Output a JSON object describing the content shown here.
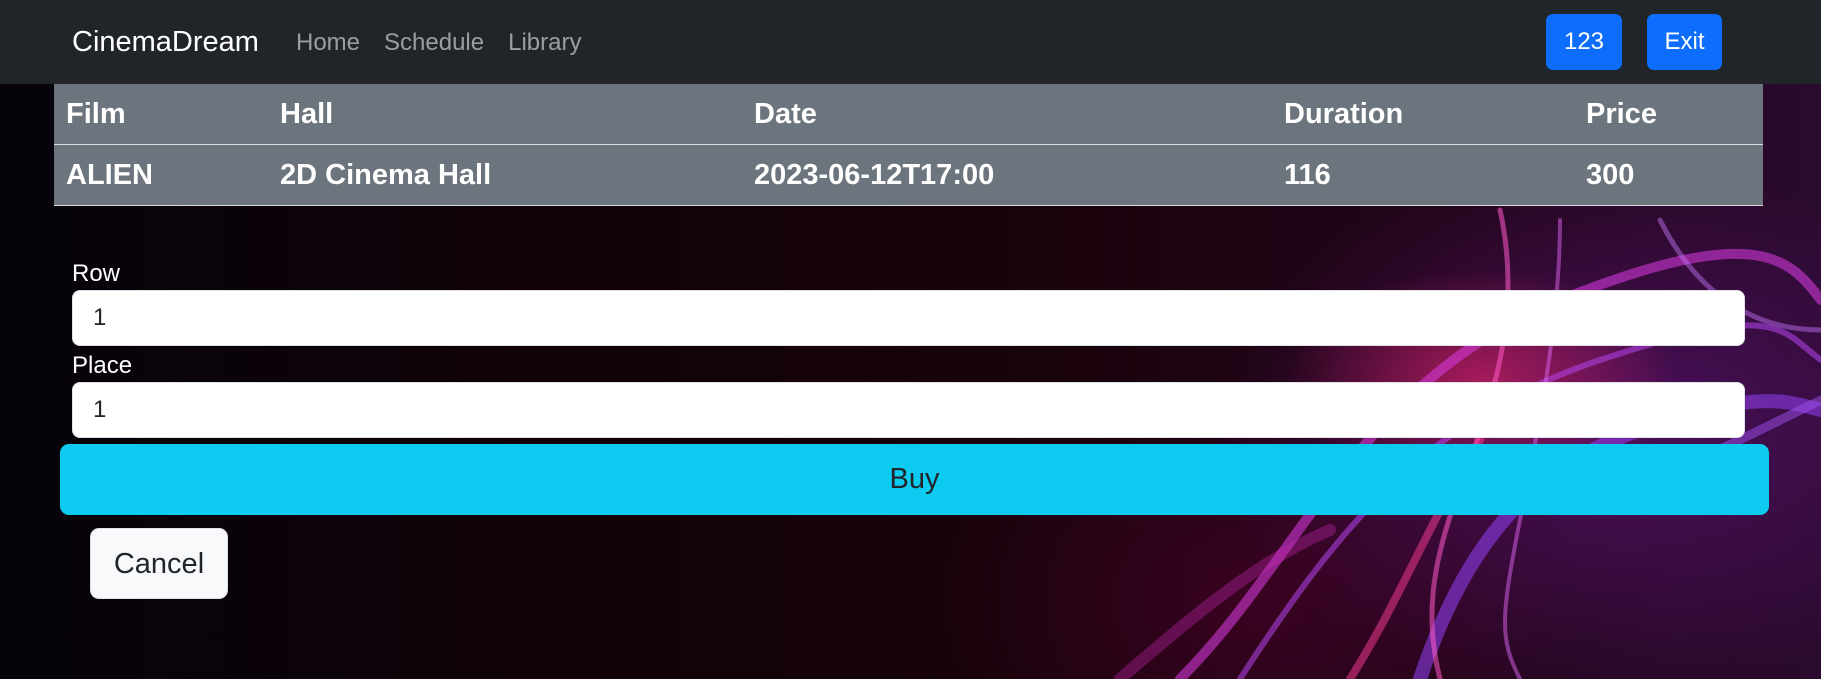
{
  "navbar": {
    "brand": "CinemaDream",
    "links": [
      "Home",
      "Schedule",
      "Library"
    ],
    "user_button": "123",
    "exit_button": "Exit",
    "color": "#212529"
  },
  "session_table": {
    "headers": [
      "Film",
      "Hall",
      "Date",
      "Duration",
      "Price"
    ],
    "rows": [
      [
        "ALIEN",
        "2D Cinema Hall",
        "2023-06-12T17:00",
        "116",
        "300"
      ]
    ],
    "color": "#6c757d"
  },
  "form": {
    "row_label": "Row",
    "row_value": "1",
    "place_label": "Place",
    "place_value": "1",
    "buy_button": "Buy",
    "cancel_button": "Cancel",
    "buy_color": "#0dcaf0",
    "primary_color": "#0d6efd"
  }
}
